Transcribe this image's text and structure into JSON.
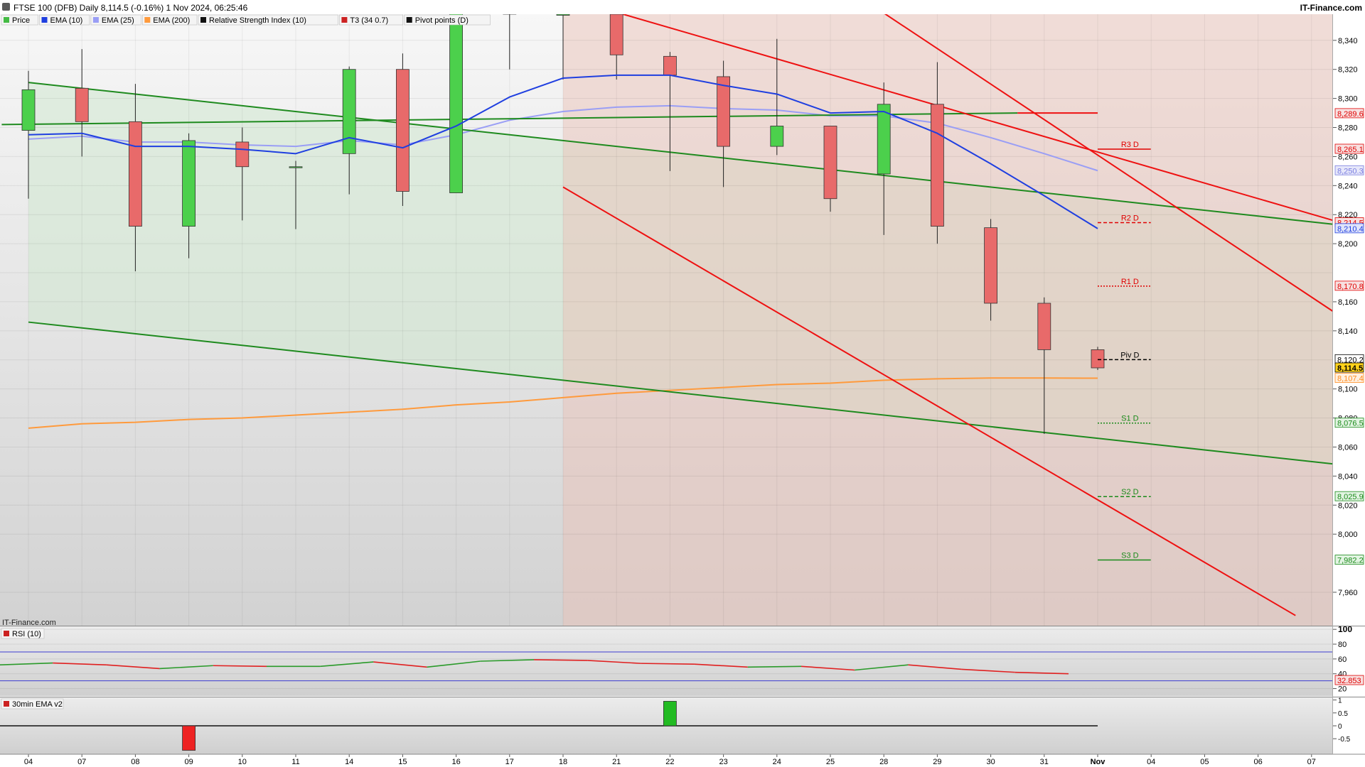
{
  "header": {
    "title": "FTSE 100 (DFB) Daily 8,114.5 (-0.16%) 1 Nov 2024, 06:25:46",
    "brand": "IT-Finance.com",
    "watermark": "IT-Finance.com"
  },
  "legend": [
    {
      "label": "Price",
      "color": "#44bb44"
    },
    {
      "label": "EMA (10)",
      "color": "#1f3fe0"
    },
    {
      "label": "EMA (25)",
      "color": "#9a9ef5"
    },
    {
      "label": "EMA (200)",
      "color": "#ff9a3c"
    },
    {
      "label": "Relative Strength Index (10)",
      "color": "#111111"
    },
    {
      "label": "T3 (34 0.7)",
      "color": "#cc2222"
    },
    {
      "label": "Pivot points (D)",
      "color": "#111111"
    }
  ],
  "colors": {
    "up": "#4cd04c",
    "down": "#e86a6a",
    "ema10": "#1f3fe0",
    "ema25": "#9a9ef5",
    "ema200": "#ff9a3c",
    "trend_green": "#1e8a1e",
    "trend_red": "#ee1111"
  },
  "chart_data": [
    {
      "type": "candlestick",
      "title": "FTSE 100 (DFB) Daily",
      "ylim": [
        7937,
        8358
      ],
      "yticks": [
        7960,
        8000,
        8020,
        8040,
        8060,
        8080,
        8100,
        8140,
        8160,
        8200,
        8220,
        8240,
        8260,
        8280,
        8300,
        8320,
        8340
      ],
      "x_labels": [
        "04",
        "07",
        "08",
        "09",
        "10",
        "11",
        "14",
        "15",
        "16",
        "17",
        "18",
        "21",
        "22",
        "23",
        "24",
        "25",
        "28",
        "29",
        "30",
        "31",
        "Nov",
        "04",
        "05",
        "06",
        "07"
      ],
      "candles": [
        {
          "o": 8278,
          "h": 8319,
          "l": 8231,
          "c": 8306
        },
        {
          "o": 8307,
          "h": 8334,
          "l": 8260,
          "c": 8284
        },
        {
          "o": 8284,
          "h": 8310,
          "l": 8181,
          "c": 8212
        },
        {
          "o": 8212,
          "h": 8276,
          "l": 8190,
          "c": 8271
        },
        {
          "o": 8270,
          "h": 8280,
          "l": 8216,
          "c": 8253
        },
        {
          "o": 8253,
          "h": 8257,
          "l": 8210,
          "c": 8253
        },
        {
          "o": 8262,
          "h": 8322,
          "l": 8234,
          "c": 8320
        },
        {
          "o": 8320,
          "h": 8331,
          "l": 8226,
          "c": 8236
        },
        {
          "o": 8235,
          "h": 8362,
          "l": 8235,
          "c": 8362
        },
        {
          "o": 8362,
          "h": 8362,
          "l": 8320,
          "c": 8358
        },
        {
          "o": 8358,
          "h": 8365,
          "l": 8313,
          "c": 8358
        },
        {
          "o": 8358,
          "h": 8358,
          "l": 8313,
          "c": 8330
        },
        {
          "o": 8329,
          "h": 8332,
          "l": 8250,
          "c": 8316
        },
        {
          "o": 8315,
          "h": 8326,
          "l": 8239,
          "c": 8267
        },
        {
          "o": 8267,
          "h": 8341,
          "l": 8261,
          "c": 8281
        },
        {
          "o": 8281,
          "h": 8281,
          "l": 8222,
          "c": 8231
        },
        {
          "o": 8248,
          "h": 8311,
          "l": 8206,
          "c": 8296
        },
        {
          "o": 8296,
          "h": 8325,
          "l": 8200,
          "c": 8212
        },
        {
          "o": 8211,
          "h": 8217,
          "l": 8147,
          "c": 8159
        },
        {
          "o": 8159,
          "h": 8163,
          "l": 8069,
          "c": 8127
        },
        {
          "o": 8127,
          "h": 8129,
          "l": 8113,
          "c": 8114.5
        }
      ],
      "ema10": [
        8275,
        8276,
        8267,
        8267,
        8265,
        8262,
        8273,
        8266,
        8281,
        8301,
        8314,
        8316,
        8316,
        8309,
        8303,
        8290,
        8291,
        8276,
        8255,
        8233,
        8210.4
      ],
      "ema25": [
        8272,
        8274,
        8270,
        8270,
        8268,
        8267,
        8271,
        8268,
        8275,
        8285,
        8291,
        8294,
        8295,
        8293,
        8292,
        8288,
        8288,
        8283,
        8273,
        8262,
        8250.3
      ],
      "ema200": [
        8073,
        8076,
        8077,
        8079,
        8080,
        8082,
        8084,
        8086,
        8089,
        8091,
        8094,
        8097,
        8099,
        8101,
        8103,
        8104,
        8106,
        8107,
        8107.5,
        8107.5,
        8107.4
      ],
      "trendlines": [
        {
          "color": "green",
          "from": [
            0,
            8311
          ],
          "to": [
            24.5,
            8213
          ]
        },
        {
          "color": "green",
          "from": [
            0,
            8146
          ],
          "to": [
            24.5,
            8048
          ]
        },
        {
          "color": "green",
          "from": [
            -0.5,
            8282
          ],
          "to": [
            18.5,
            8290
          ]
        },
        {
          "color": "red",
          "from": [
            18.5,
            8290
          ],
          "to": [
            20,
            8290
          ]
        },
        {
          "color": "red",
          "from": [
            10,
            8370
          ],
          "to": [
            24.5,
            8215
          ]
        },
        {
          "color": "red",
          "from": [
            15.5,
            8371
          ],
          "to": [
            24.5,
            8151
          ]
        },
        {
          "color": "red",
          "from": [
            10,
            8239
          ],
          "to": [
            23.7,
            7944
          ]
        }
      ],
      "pivots": [
        {
          "label": "R3 D",
          "value": 8265.1,
          "color": "#e00000",
          "style": "solid"
        },
        {
          "label": "R2 D",
          "value": 8214.5,
          "color": "#e00000",
          "style": "dashed"
        },
        {
          "label": "R1 D",
          "value": 8170.8,
          "color": "#e00000",
          "style": "dotted"
        },
        {
          "label": "Piv D",
          "value": 8120.2,
          "color": "#000000",
          "style": "dashed"
        },
        {
          "label": "S1 D",
          "value": 8076.5,
          "color": "#1a8a1a",
          "style": "dotted"
        },
        {
          "label": "S2 D",
          "value": 8025.9,
          "color": "#1a8a1a",
          "style": "dashed"
        },
        {
          "label": "S3 D",
          "value": 7982.2,
          "color": "#1a8a1a",
          "style": "solid"
        }
      ],
      "price_tags": [
        {
          "text": "8,289.6",
          "value": 8289.6,
          "color": "#e00000",
          "bg": "#f7e0e0",
          "bold": false
        },
        {
          "text": "8,265.1",
          "value": 8265.1,
          "color": "#e00000",
          "bg": "#f7e0e0",
          "bold": false
        },
        {
          "text": "8,250.3",
          "value": 8250.3,
          "color": "#7a7ee0",
          "bg": "#e6e7fa",
          "bold": false
        },
        {
          "text": "8,214.5",
          "value": 8214.5,
          "color": "#e00000",
          "bg": "#f7e0e0",
          "bold": false
        },
        {
          "text": "8,210.4",
          "value": 8210.4,
          "color": "#1f3fe0",
          "bg": "#e0e4fa",
          "bold": false
        },
        {
          "text": "8,170.8",
          "value": 8170.8,
          "color": "#e00000",
          "bg": "#f7e0e0",
          "bold": false
        },
        {
          "text": "8,120.2",
          "value": 8120.2,
          "color": "#000000",
          "bg": "#ffffff",
          "bold": false
        },
        {
          "text": "8,114.5",
          "value": 8114.5,
          "color": "#000000",
          "bg": "#ffd21a",
          "bold": true
        },
        {
          "text": "8,107.4",
          "value": 8107.4,
          "color": "#ff8a1c",
          "bg": "#fff0e0",
          "bold": false
        },
        {
          "text": "8,076.5",
          "value": 8076.5,
          "color": "#1a8a1a",
          "bg": "#e2f4e2",
          "bold": false
        },
        {
          "text": "8,025.9",
          "value": 8025.9,
          "color": "#1a8a1a",
          "bg": "#e2f4e2",
          "bold": false
        },
        {
          "text": "7,982.2",
          "value": 7982.2,
          "color": "#1a8a1a",
          "bg": "#e2f4e2",
          "bold": false
        }
      ]
    },
    {
      "type": "line",
      "title": "RSI (10)",
      "ylim": [
        10,
        104
      ],
      "yticks": [
        100,
        80,
        60,
        40,
        20
      ],
      "bands": [
        69.5,
        30.5
      ],
      "values": [
        52,
        54.5,
        52,
        47,
        51,
        50,
        50,
        56,
        49,
        57,
        59,
        58,
        54,
        53,
        49,
        50,
        45,
        52,
        46,
        42,
        40,
        39.5,
        39.5
      ],
      "last_label": "32.853"
    },
    {
      "type": "bar",
      "title": "30min EMA v2",
      "ylim": [
        -1.1,
        1.1
      ],
      "yticks": [
        "1",
        "0.5",
        "0",
        "-0.5"
      ],
      "bars": [
        {
          "x": 3,
          "value": -1,
          "color": "red"
        },
        {
          "x": 12,
          "value": 1,
          "color": "green"
        }
      ]
    }
  ]
}
